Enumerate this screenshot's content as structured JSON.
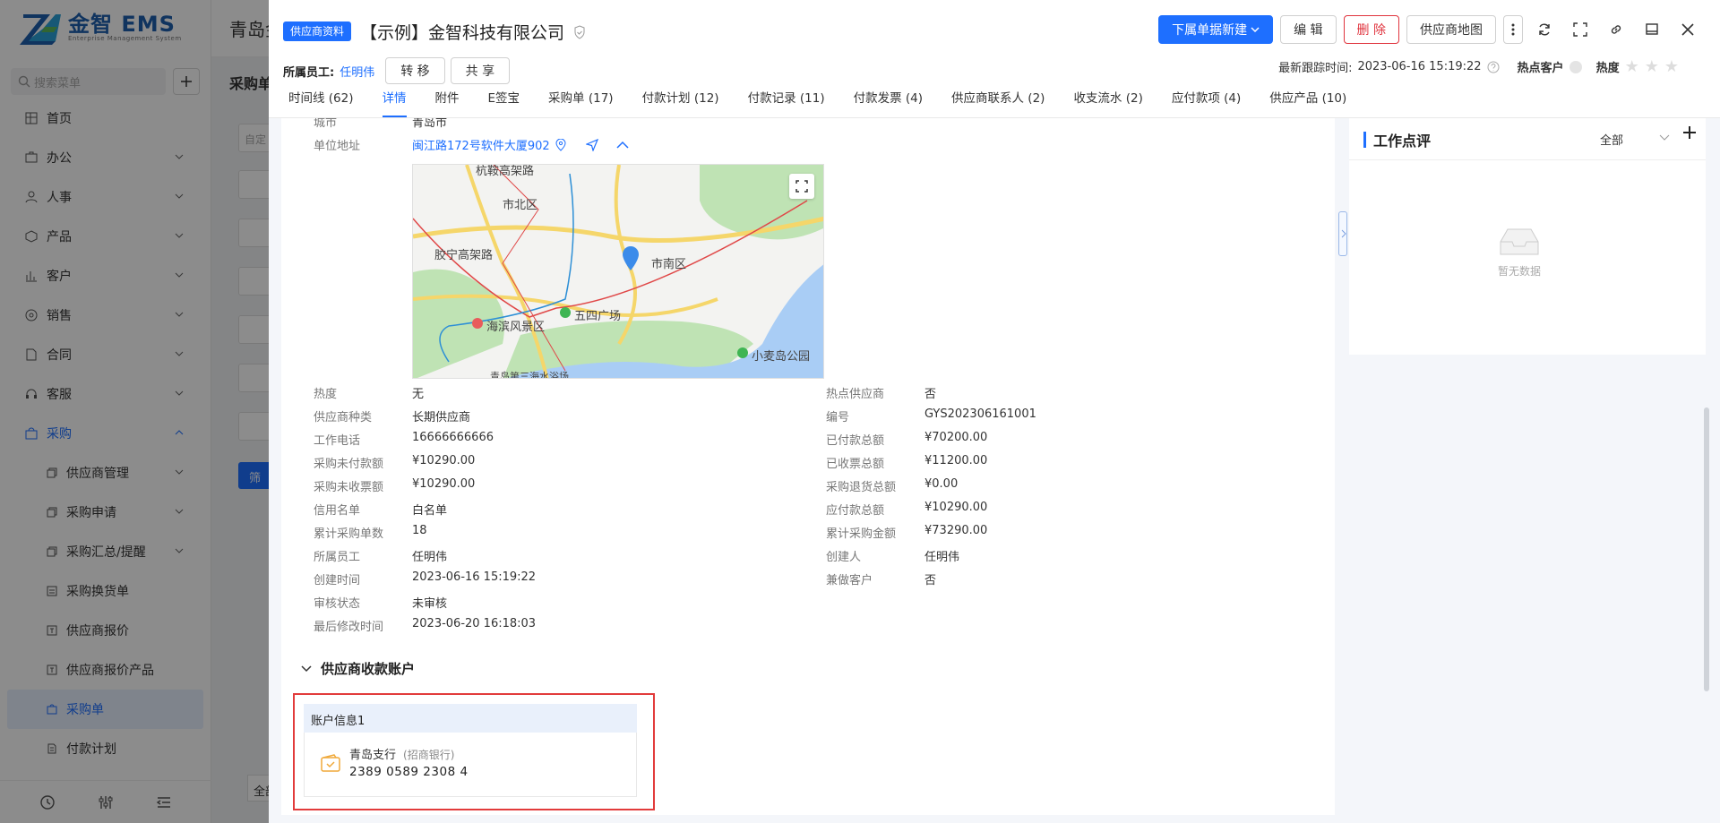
{
  "app": {
    "brand": "金智 EMS",
    "brand_sub": "Enterprise Management System"
  },
  "sidebar": {
    "search_placeholder": "搜索菜单",
    "items": [
      {
        "label": "首页"
      },
      {
        "label": "办公"
      },
      {
        "label": "人事"
      },
      {
        "label": "产品"
      },
      {
        "label": "客户"
      },
      {
        "label": "销售"
      },
      {
        "label": "合同"
      },
      {
        "label": "客服"
      },
      {
        "label": "采购"
      }
    ],
    "sub_items": [
      {
        "label": "供应商管理"
      },
      {
        "label": "采购申请"
      },
      {
        "label": "采购汇总/提醒"
      },
      {
        "label": "采购换货单"
      },
      {
        "label": "供应商报价"
      },
      {
        "label": "供应商报价产品"
      },
      {
        "label": "采购单"
      },
      {
        "label": "付款计划"
      }
    ]
  },
  "background": {
    "header": "青岛金",
    "crumb": "采购单",
    "filter_btn": "筛",
    "all_label": "全部",
    "input_hint": "自定"
  },
  "drawer": {
    "tag": "供应商资料",
    "title": "【示例】金智科技有限公司",
    "buttons": {
      "new": "下属单据新建",
      "edit": "编 辑",
      "delete": "删 除",
      "map": "供应商地图"
    },
    "owner_label": "所属员工:",
    "owner_name": "任明伟",
    "transfer": "转 移",
    "share": "共 享",
    "follow_label": "最新跟踪时间:",
    "follow_time": "2023-06-16 15:19:22",
    "hot_customer": "热点客户",
    "heat": "热度",
    "tabs": [
      "时间线 (62)",
      "详情",
      "附件",
      "E签宝",
      "采购单 (17)",
      "付款计划 (12)",
      "付款记录 (11)",
      "付款发票 (4)",
      "供应商联系人 (2)",
      "收支流水 (2)",
      "应付款项 (4)",
      "供应产品 (10)"
    ],
    "active_tab": "详情"
  },
  "detail": {
    "city_label": "城市",
    "city_value": "青岛市",
    "address_label": "单位地址",
    "address_value": "闽江路172号软件大厦902",
    "map_labels": {
      "a": "杭鞍高架路",
      "b": "市北区",
      "c": "胶宁高架路",
      "d": "市南区",
      "e": "海滨风景区",
      "f": "五四广场",
      "g": "小麦岛公园",
      "h": "青岛第三海水浴场"
    },
    "left": [
      {
        "label": "热度",
        "value": "无"
      },
      {
        "label": "供应商种类",
        "value": "长期供应商"
      },
      {
        "label": "工作电话",
        "value": "16666666666"
      },
      {
        "label": "采购未付款额",
        "value": "¥10290.00"
      },
      {
        "label": "采购未收票额",
        "value": "¥10290.00"
      },
      {
        "label": "信用名单",
        "value": "白名单"
      },
      {
        "label": "累计采购单数",
        "value": "18"
      },
      {
        "label": "所属员工",
        "value": "任明伟"
      },
      {
        "label": "创建时间",
        "value": "2023-06-16 15:19:22"
      },
      {
        "label": "审核状态",
        "value": "未审核"
      },
      {
        "label": "最后修改时间",
        "value": "2023-06-20 16:18:03"
      }
    ],
    "right": [
      {
        "label": "热点供应商",
        "value": "否"
      },
      {
        "label": "编号",
        "value": "GYS202306161001"
      },
      {
        "label": "已付款总额",
        "value": "¥70200.00"
      },
      {
        "label": "已收票总额",
        "value": "¥11200.00"
      },
      {
        "label": "采购退货总额",
        "value": "¥0.00"
      },
      {
        "label": "应付款总额",
        "value": "¥10290.00"
      },
      {
        "label": "累计采购金额",
        "value": "¥73290.00"
      },
      {
        "label": "创建人",
        "value": "任明伟"
      },
      {
        "label": "兼做客户",
        "value": "否"
      }
    ],
    "section_title": "供应商收款账户",
    "account": {
      "title": "账户信息1",
      "branch": "青岛支行",
      "bank": "(招商银行)",
      "number": "2389 0589 2308 4"
    }
  },
  "review": {
    "title": "工作点评",
    "filter": "全部",
    "empty": "暂无数据"
  }
}
